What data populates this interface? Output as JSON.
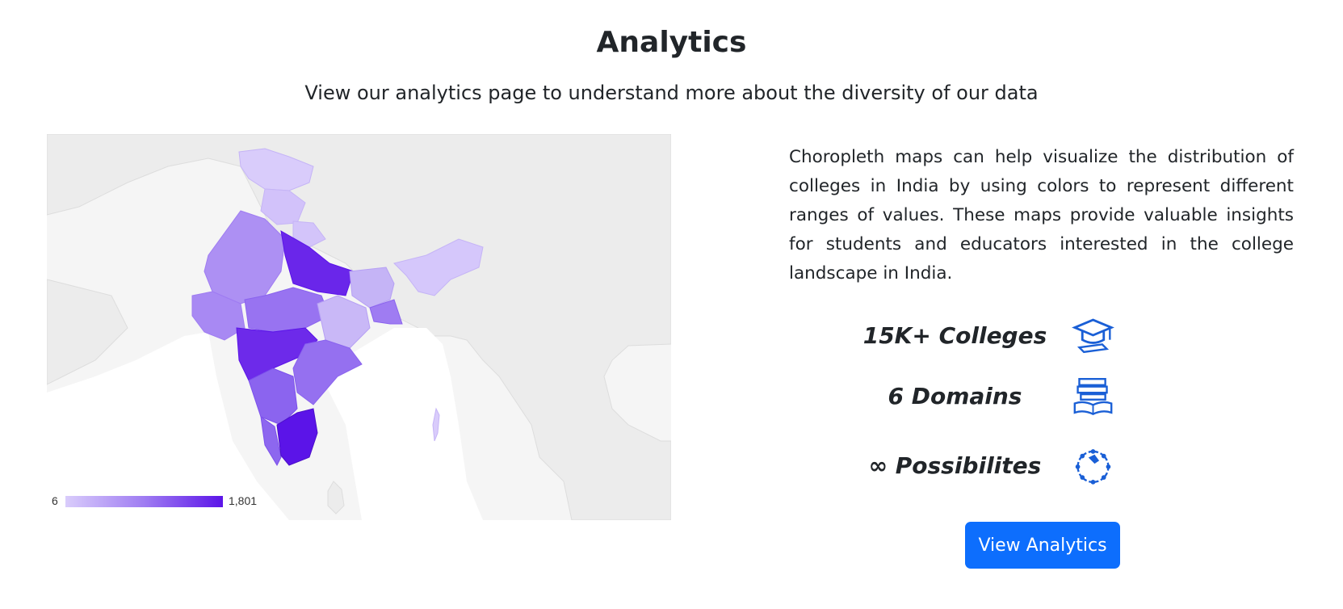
{
  "header": {
    "title": "Analytics",
    "subtitle": "View our analytics page to understand more about the diversity of our data"
  },
  "map": {
    "legend_min": "6",
    "legend_max": "1,801",
    "color_low": "#d9ccfb",
    "color_high": "#5b14e8",
    "background": "#f5f5f5"
  },
  "description": "Choropleth maps can help visualize the distribution of colleges in India by using colors to represent different ranges of values. These maps provide valuable insights for students and educators interested in the college landscape in India.",
  "stats": [
    {
      "label": "15K+ Colleges",
      "icon": "graduation-cap-icon"
    },
    {
      "label": "6 Domains",
      "icon": "books-icon"
    },
    {
      "label": "∞ Possibilites",
      "icon": "network-icon"
    }
  ],
  "cta": {
    "label": "View Analytics"
  },
  "colors": {
    "button": "#0d6efd",
    "icon": "#1a5fd6"
  }
}
